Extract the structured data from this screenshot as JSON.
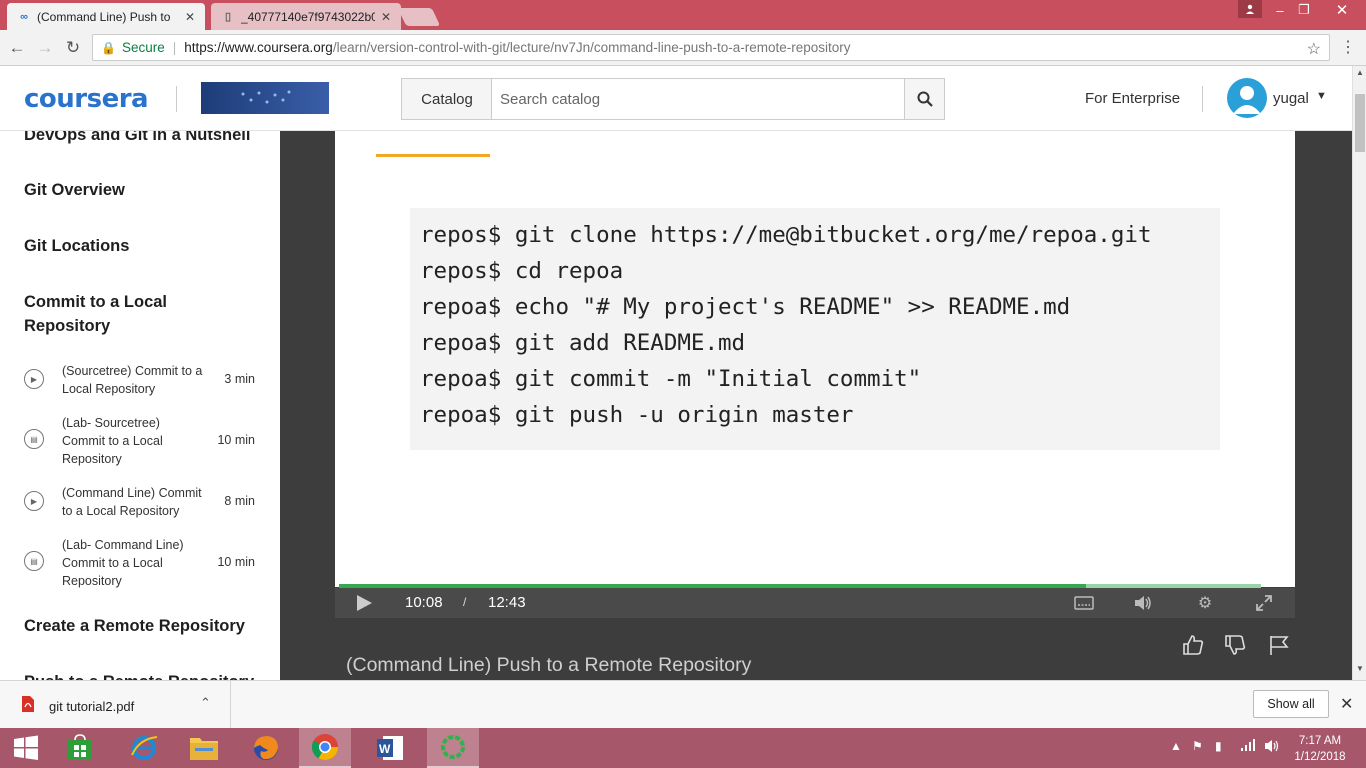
{
  "browser": {
    "tabs": [
      {
        "title": "(Command Line) Push to",
        "icon": "coursera-icon",
        "active": true
      },
      {
        "title": "_40777140e7f9743022b0",
        "icon": "document-icon",
        "active": false
      }
    ],
    "address": {
      "secure_label": "Secure",
      "url_host": "https://www.coursera.org",
      "url_path": "/learn/version-control-with-git/lecture/nv7Jn/command-line-push-to-a-remote-repository"
    }
  },
  "header": {
    "logo_text": "coursera",
    "catalog_label": "Catalog",
    "search_placeholder": "Search catalog",
    "enterprise_label": "For Enterprise",
    "username": "yugal",
    "brand_color": "#2a73cc"
  },
  "sidebar": {
    "sections": [
      {
        "title": "DevOps and Git in a Nutshell"
      },
      {
        "title": "Git Overview"
      },
      {
        "title": "Git Locations"
      },
      {
        "title": "Commit to a Local Repository"
      }
    ],
    "items": [
      {
        "label": "(Sourcetree) Commit to a Local Repository",
        "duration": "3 min",
        "icon": "play-icon"
      },
      {
        "label": "(Lab- Sourcetree) Commit to a Local Repository",
        "duration": "10 min",
        "icon": "lab-icon"
      },
      {
        "label": "(Command Line) Commit to a Local Repository",
        "duration": "8 min",
        "icon": "play-icon"
      },
      {
        "label": "(Lab- Command Line) Commit to a Local Repository",
        "duration": "10 min",
        "icon": "lab-icon"
      }
    ],
    "next_sections": [
      {
        "title": "Create a Remote Repository"
      },
      {
        "title": "Push to a Remote Repository"
      }
    ]
  },
  "video": {
    "code_lines": [
      "repos$ git clone https://me@bitbucket.org/me/repoa.git",
      "repos$ cd repoa",
      "repoa$ echo \"# My project's README\" >> README.md",
      "repoa$ git add README.md",
      "repoa$ git commit -m \"Initial commit\"",
      "repoa$ git push -u origin master"
    ],
    "current_time": "10:08",
    "time_separator": "/",
    "total_time": "12:43",
    "progress_fraction": 0.81,
    "lecture_title": "(Command Line) Push to a Remote Repository"
  },
  "downloads": {
    "file_name": "git tutorial2.pdf",
    "show_all_label": "Show all"
  },
  "taskbar": {
    "time": "7:17 AM",
    "date": "1/12/2018"
  }
}
